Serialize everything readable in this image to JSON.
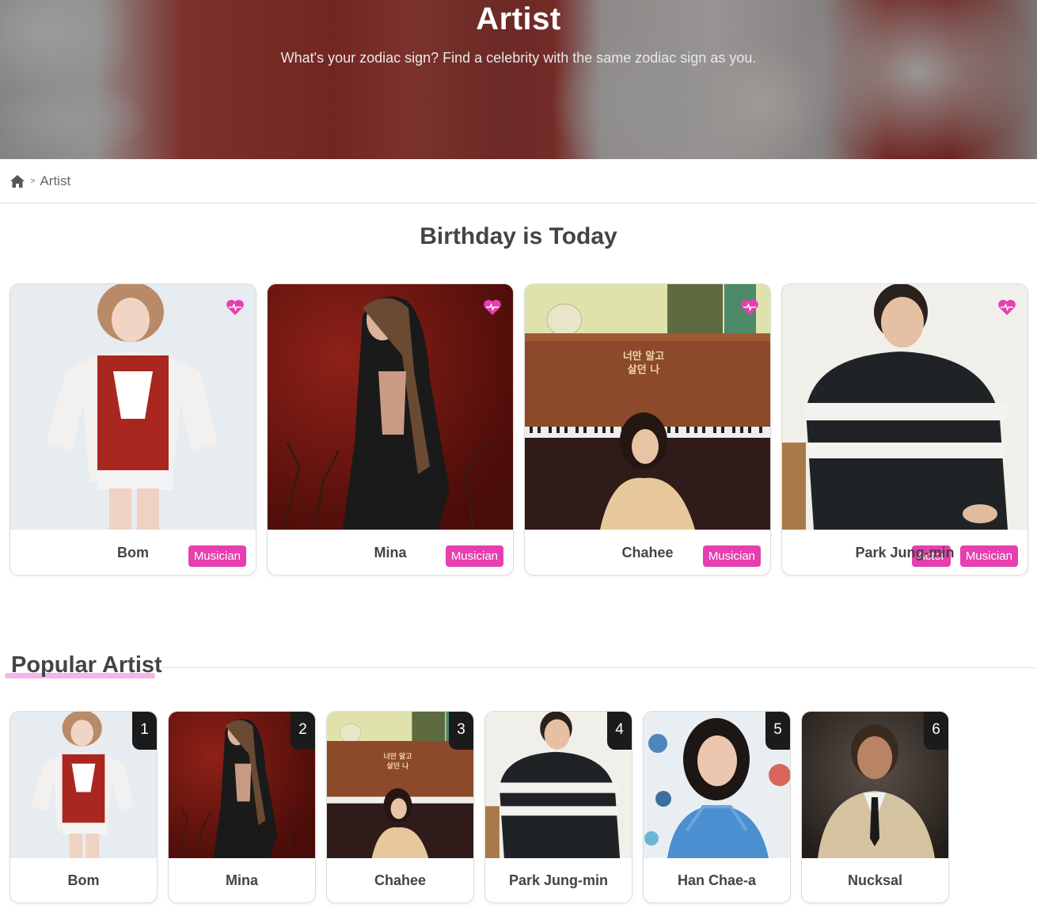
{
  "hero": {
    "title": "Artist",
    "subtitle": "What's your zodiac sign? Find a celebrity with the same zodiac sign as you."
  },
  "breadcrumb": {
    "home_icon": "home-icon",
    "separator": ">",
    "current": "Artist"
  },
  "birthday": {
    "title": "Birthday is Today",
    "cards": [
      {
        "name": "Bom",
        "tags": [
          "Musician"
        ]
      },
      {
        "name": "Mina",
        "tags": [
          "Musician"
        ]
      },
      {
        "name": "Chahee",
        "tags": [
          "Musician"
        ]
      },
      {
        "name": "Park Jung-min",
        "tags": [
          "Actor",
          "Musician"
        ]
      }
    ]
  },
  "popular": {
    "title": "Popular Artist",
    "cards": [
      {
        "rank": "1",
        "name": "Bom"
      },
      {
        "rank": "2",
        "name": "Mina"
      },
      {
        "rank": "3",
        "name": "Chahee"
      },
      {
        "rank": "4",
        "name": "Park Jung-min"
      },
      {
        "rank": "5",
        "name": "Han Chae-a"
      },
      {
        "rank": "6",
        "name": "Nucksal"
      }
    ]
  },
  "colors": {
    "accent": "#e63fb0",
    "underline": "#f5b5e8",
    "rank_badge": "#1b1b1b"
  },
  "photo_texts": {
    "piano_sign": "너만 알고\n살던 나"
  }
}
